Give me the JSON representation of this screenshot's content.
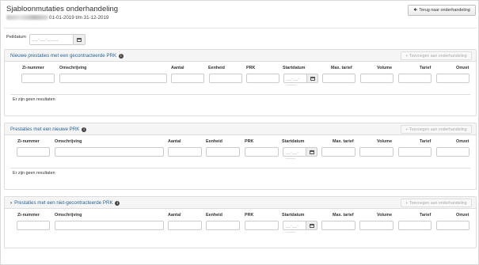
{
  "page": {
    "title": "Sjabloonmutaties onderhandeling",
    "subtitle_period": "01-01-2019 t/m 31-12-2019",
    "back_button": "Terug naar onderhandeling",
    "peildatum_label": "Peildatum",
    "peildatum_placeholder": "__-__-____"
  },
  "columns": [
    "Zi-nummer",
    "Omschrijving",
    "Aantal",
    "Eenheid",
    "PRK",
    "Startdatum",
    "Max. tarief",
    "Volume",
    "Tarief",
    "Omzet"
  ],
  "date_placeholder": "__-__-____",
  "panels": [
    {
      "title": "Nieuwe prestaties met een gecontracteerde PRK",
      "add_button": "Toevoegen aan onderhandeling",
      "empty_text": "Er zijn geen resultaten"
    },
    {
      "title": "Prestaties met een nieuwe PRK",
      "add_button": "Toevoegen aan onderhandeling",
      "empty_text": "Er zijn geen resultaten"
    },
    {
      "title": "Prestaties met een niet-gecontracteerde PRK",
      "add_button": "Toevoegen aan onderhandeling"
    }
  ],
  "icons": {
    "back": "arrow-left-icon",
    "add": "plus-icon",
    "info": "info-icon",
    "calendar": "calendar-icon",
    "expand": "chevron-right-icon"
  },
  "colors": {
    "panel_title": "#2a6496",
    "panel_header_bg": "#f5f5f5"
  }
}
